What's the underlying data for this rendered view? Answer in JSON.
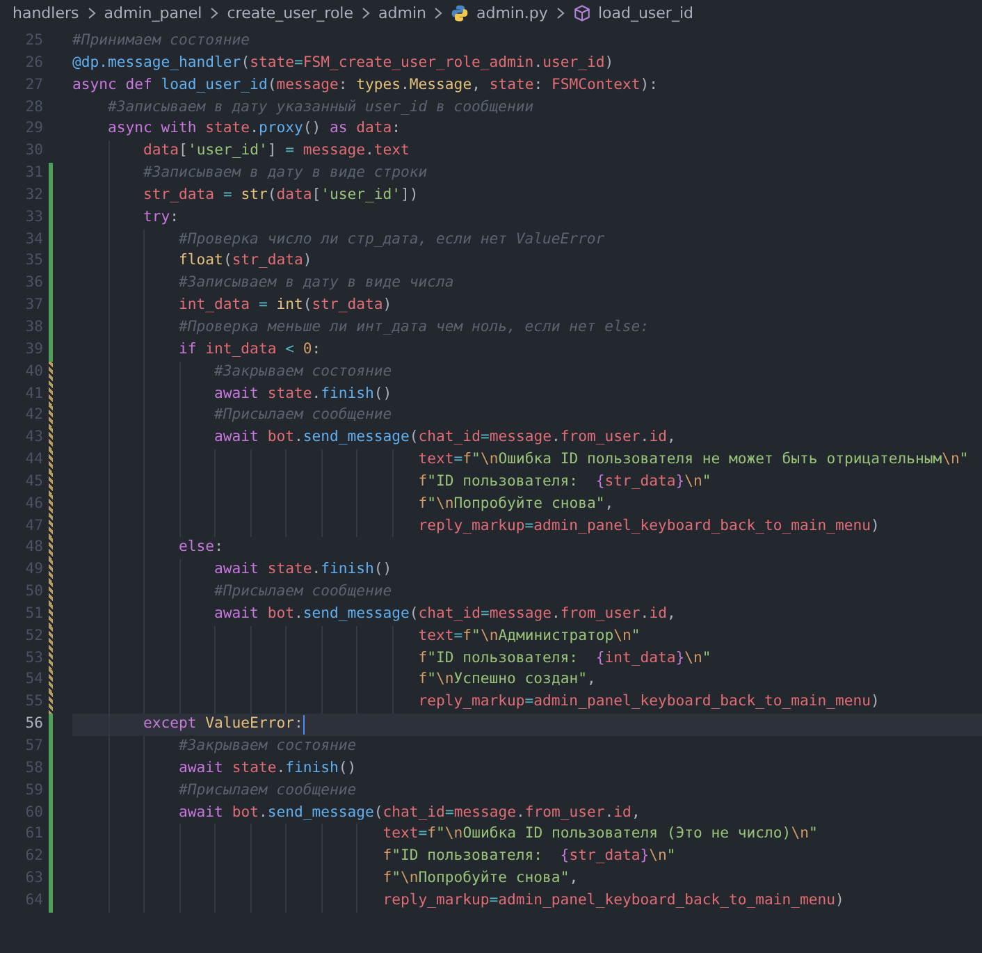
{
  "breadcrumb": [
    {
      "kind": "folder",
      "label": "handlers"
    },
    {
      "kind": "folder",
      "label": "admin_panel"
    },
    {
      "kind": "folder",
      "label": "create_user_role"
    },
    {
      "kind": "folder",
      "label": "admin"
    },
    {
      "kind": "file",
      "label": "admin.py"
    },
    {
      "kind": "symbol",
      "label": "load_user_id"
    }
  ],
  "lines": [
    {
      "number": "25",
      "added": false,
      "modified": false,
      "current": false,
      "tokens": [
        {
          "kind": "comment",
          "text": "#Принимаем состояние"
        }
      ]
    },
    {
      "number": "26",
      "added": false,
      "modified": false,
      "current": false,
      "tokens": [
        {
          "kind": "function",
          "text": "@dp.message_handler"
        },
        {
          "kind": "punct",
          "text": "("
        },
        {
          "kind": "variable",
          "text": "state"
        },
        {
          "kind": "operator",
          "text": "="
        },
        {
          "kind": "variable",
          "text": "FSM_create_user_role_admin"
        },
        {
          "kind": "punct",
          "text": "."
        },
        {
          "kind": "variable",
          "text": "user_id"
        },
        {
          "kind": "punct",
          "text": ")"
        }
      ]
    },
    {
      "number": "27",
      "added": false,
      "modified": false,
      "current": false,
      "tokens": [
        {
          "kind": "keyword",
          "text": "async def "
        },
        {
          "kind": "function",
          "text": "load_user_id"
        },
        {
          "kind": "punct",
          "text": "("
        },
        {
          "kind": "variable",
          "text": "message"
        },
        {
          "kind": "punct",
          "text": ": "
        },
        {
          "kind": "type",
          "text": "types"
        },
        {
          "kind": "punct",
          "text": "."
        },
        {
          "kind": "type",
          "text": "Message"
        },
        {
          "kind": "punct",
          "text": ", "
        },
        {
          "kind": "variable",
          "text": "state"
        },
        {
          "kind": "punct",
          "text": ": "
        },
        {
          "kind": "variable",
          "text": "FSMContext"
        },
        {
          "kind": "punct",
          "text": "):"
        }
      ]
    },
    {
      "number": "28",
      "added": false,
      "modified": false,
      "current": false,
      "tokens": [
        {
          "kind": "comment",
          "text": "    #Записываем в дату указанный user_id в сообщении"
        }
      ]
    },
    {
      "number": "29",
      "added": false,
      "modified": false,
      "current": false,
      "tokens": [
        {
          "kind": "keyword",
          "text": "    async with "
        },
        {
          "kind": "variable",
          "text": "state"
        },
        {
          "kind": "punct",
          "text": "."
        },
        {
          "kind": "function",
          "text": "proxy"
        },
        {
          "kind": "punct",
          "text": "() "
        },
        {
          "kind": "keyword",
          "text": "as "
        },
        {
          "kind": "variable",
          "text": "data"
        },
        {
          "kind": "punct",
          "text": ":"
        }
      ]
    },
    {
      "number": "30",
      "added": false,
      "modified": false,
      "current": false,
      "tokens": [
        {
          "kind": "variable",
          "text": "        data"
        },
        {
          "kind": "punct",
          "text": "["
        },
        {
          "kind": "string",
          "text": "'user_id'"
        },
        {
          "kind": "punct",
          "text": "] "
        },
        {
          "kind": "operator",
          "text": "= "
        },
        {
          "kind": "variable",
          "text": "message"
        },
        {
          "kind": "punct",
          "text": "."
        },
        {
          "kind": "variable",
          "text": "text"
        }
      ]
    },
    {
      "number": "31",
      "added": true,
      "modified": false,
      "current": false,
      "tokens": [
        {
          "kind": "comment",
          "text": "        #Записываем в дату в виде строки"
        }
      ]
    },
    {
      "number": "32",
      "added": true,
      "modified": false,
      "current": false,
      "tokens": [
        {
          "kind": "variable",
          "text": "        str_data"
        },
        {
          "kind": "operator",
          "text": " = "
        },
        {
          "kind": "type",
          "text": "str"
        },
        {
          "kind": "punct",
          "text": "("
        },
        {
          "kind": "variable",
          "text": "data"
        },
        {
          "kind": "punct",
          "text": "["
        },
        {
          "kind": "string",
          "text": "'user_id'"
        },
        {
          "kind": "punct",
          "text": "])"
        }
      ]
    },
    {
      "number": "33",
      "added": true,
      "modified": false,
      "current": false,
      "tokens": [
        {
          "kind": "keyword",
          "text": "        try"
        },
        {
          "kind": "punct",
          "text": ":"
        }
      ]
    },
    {
      "number": "34",
      "added": true,
      "modified": false,
      "current": false,
      "tokens": [
        {
          "kind": "comment",
          "text": "            #Проверка число ли стр_дата, если нет ValueError"
        }
      ]
    },
    {
      "number": "35",
      "added": true,
      "modified": false,
      "current": false,
      "tokens": [
        {
          "kind": "type",
          "text": "            float"
        },
        {
          "kind": "punct",
          "text": "("
        },
        {
          "kind": "variable",
          "text": "str_data"
        },
        {
          "kind": "punct",
          "text": ")"
        }
      ]
    },
    {
      "number": "36",
      "added": true,
      "modified": false,
      "current": false,
      "tokens": [
        {
          "kind": "comment",
          "text": "            #Записываем в дату в виде числа"
        }
      ]
    },
    {
      "number": "37",
      "added": true,
      "modified": false,
      "current": false,
      "tokens": [
        {
          "kind": "variable",
          "text": "            int_data"
        },
        {
          "kind": "operator",
          "text": " = "
        },
        {
          "kind": "type",
          "text": "int"
        },
        {
          "kind": "punct",
          "text": "("
        },
        {
          "kind": "variable",
          "text": "str_data"
        },
        {
          "kind": "punct",
          "text": ")"
        }
      ]
    },
    {
      "number": "38",
      "added": true,
      "modified": false,
      "current": false,
      "tokens": [
        {
          "kind": "comment",
          "text": "            #Проверка меньше ли инт_дата чем ноль, если нет else:"
        }
      ]
    },
    {
      "number": "39",
      "added": true,
      "modified": false,
      "current": false,
      "tokens": [
        {
          "kind": "keyword",
          "text": "            if "
        },
        {
          "kind": "variable",
          "text": "int_data"
        },
        {
          "kind": "operator",
          "text": " < "
        },
        {
          "kind": "number",
          "text": "0"
        },
        {
          "kind": "punct",
          "text": ":"
        }
      ]
    },
    {
      "number": "40",
      "added": false,
      "modified": true,
      "current": false,
      "tokens": [
        {
          "kind": "comment",
          "text": "                #Закрываем состояние"
        }
      ]
    },
    {
      "number": "41",
      "added": false,
      "modified": true,
      "current": false,
      "tokens": [
        {
          "kind": "keyword",
          "text": "                await "
        },
        {
          "kind": "variable",
          "text": "state"
        },
        {
          "kind": "punct",
          "text": "."
        },
        {
          "kind": "function",
          "text": "finish"
        },
        {
          "kind": "punct",
          "text": "()"
        }
      ]
    },
    {
      "number": "42",
      "added": false,
      "modified": true,
      "current": false,
      "tokens": [
        {
          "kind": "comment",
          "text": "                #Присылаем сообщение"
        }
      ]
    },
    {
      "number": "43",
      "added": false,
      "modified": true,
      "current": false,
      "tokens": [
        {
          "kind": "keyword",
          "text": "                await "
        },
        {
          "kind": "variable",
          "text": "bot"
        },
        {
          "kind": "punct",
          "text": "."
        },
        {
          "kind": "function",
          "text": "send_message"
        },
        {
          "kind": "punct",
          "text": "("
        },
        {
          "kind": "variable",
          "text": "chat_id"
        },
        {
          "kind": "operator",
          "text": "="
        },
        {
          "kind": "variable",
          "text": "message"
        },
        {
          "kind": "punct",
          "text": "."
        },
        {
          "kind": "variable",
          "text": "from_user"
        },
        {
          "kind": "punct",
          "text": "."
        },
        {
          "kind": "variable",
          "text": "id"
        },
        {
          "kind": "punct",
          "text": ","
        }
      ]
    },
    {
      "number": "44",
      "added": false,
      "modified": true,
      "current": false,
      "tokens": [
        {
          "kind": "variable",
          "text": "                                       text"
        },
        {
          "kind": "operator",
          "text": "="
        },
        {
          "kind": "number",
          "text": "f"
        },
        {
          "kind": "string",
          "text": "\""
        },
        {
          "kind": "number",
          "text": "\\n"
        },
        {
          "kind": "string",
          "text": "Ошибка ID пользователя не может быть отрицательным"
        },
        {
          "kind": "number",
          "text": "\\n"
        },
        {
          "kind": "string",
          "text": "\""
        }
      ]
    },
    {
      "number": "45",
      "added": false,
      "modified": true,
      "current": false,
      "tokens": [
        {
          "kind": "number",
          "text": "                                       f"
        },
        {
          "kind": "string",
          "text": "\"ID пользователя:  "
        },
        {
          "kind": "keyword",
          "text": "{"
        },
        {
          "kind": "variable",
          "text": "str_data"
        },
        {
          "kind": "keyword",
          "text": "}"
        },
        {
          "kind": "number",
          "text": "\\n"
        },
        {
          "kind": "string",
          "text": "\""
        }
      ]
    },
    {
      "number": "46",
      "added": false,
      "modified": true,
      "current": false,
      "tokens": [
        {
          "kind": "number",
          "text": "                                       f"
        },
        {
          "kind": "string",
          "text": "\""
        },
        {
          "kind": "number",
          "text": "\\n"
        },
        {
          "kind": "string",
          "text": "Попробуйте снова\""
        },
        {
          "kind": "punct",
          "text": ","
        }
      ]
    },
    {
      "number": "47",
      "added": false,
      "modified": true,
      "current": false,
      "tokens": [
        {
          "kind": "variable",
          "text": "                                       reply_markup"
        },
        {
          "kind": "operator",
          "text": "="
        },
        {
          "kind": "variable",
          "text": "admin_panel_keyboard_back_to_main_menu"
        },
        {
          "kind": "punct",
          "text": ")"
        }
      ]
    },
    {
      "number": "48",
      "added": false,
      "modified": true,
      "current": false,
      "tokens": [
        {
          "kind": "keyword",
          "text": "            else"
        },
        {
          "kind": "punct",
          "text": ":"
        }
      ]
    },
    {
      "number": "49",
      "added": false,
      "modified": true,
      "current": false,
      "tokens": [
        {
          "kind": "keyword",
          "text": "                await "
        },
        {
          "kind": "variable",
          "text": "state"
        },
        {
          "kind": "punct",
          "text": "."
        },
        {
          "kind": "function",
          "text": "finish"
        },
        {
          "kind": "punct",
          "text": "()"
        }
      ]
    },
    {
      "number": "50",
      "added": false,
      "modified": true,
      "current": false,
      "tokens": [
        {
          "kind": "comment",
          "text": "                #Присылаем сообщение"
        }
      ]
    },
    {
      "number": "51",
      "added": false,
      "modified": true,
      "current": false,
      "tokens": [
        {
          "kind": "keyword",
          "text": "                await "
        },
        {
          "kind": "variable",
          "text": "bot"
        },
        {
          "kind": "punct",
          "text": "."
        },
        {
          "kind": "function",
          "text": "send_message"
        },
        {
          "kind": "punct",
          "text": "("
        },
        {
          "kind": "variable",
          "text": "chat_id"
        },
        {
          "kind": "operator",
          "text": "="
        },
        {
          "kind": "variable",
          "text": "message"
        },
        {
          "kind": "punct",
          "text": "."
        },
        {
          "kind": "variable",
          "text": "from_user"
        },
        {
          "kind": "punct",
          "text": "."
        },
        {
          "kind": "variable",
          "text": "id"
        },
        {
          "kind": "punct",
          "text": ","
        }
      ]
    },
    {
      "number": "52",
      "added": false,
      "modified": true,
      "current": false,
      "tokens": [
        {
          "kind": "variable",
          "text": "                                       text"
        },
        {
          "kind": "operator",
          "text": "="
        },
        {
          "kind": "number",
          "text": "f"
        },
        {
          "kind": "string",
          "text": "\""
        },
        {
          "kind": "number",
          "text": "\\n"
        },
        {
          "kind": "string",
          "text": "Администратор"
        },
        {
          "kind": "number",
          "text": "\\n"
        },
        {
          "kind": "string",
          "text": "\""
        }
      ]
    },
    {
      "number": "53",
      "added": false,
      "modified": true,
      "current": false,
      "tokens": [
        {
          "kind": "number",
          "text": "                                       f"
        },
        {
          "kind": "string",
          "text": "\"ID пользователя:  "
        },
        {
          "kind": "keyword",
          "text": "{"
        },
        {
          "kind": "variable",
          "text": "int_data"
        },
        {
          "kind": "keyword",
          "text": "}"
        },
        {
          "kind": "number",
          "text": "\\n"
        },
        {
          "kind": "string",
          "text": "\""
        }
      ]
    },
    {
      "number": "54",
      "added": false,
      "modified": true,
      "current": false,
      "tokens": [
        {
          "kind": "number",
          "text": "                                       f"
        },
        {
          "kind": "string",
          "text": "\""
        },
        {
          "kind": "number",
          "text": "\\n"
        },
        {
          "kind": "string",
          "text": "Успешно создан\""
        },
        {
          "kind": "punct",
          "text": ","
        }
      ]
    },
    {
      "number": "55",
      "added": false,
      "modified": true,
      "current": false,
      "tokens": [
        {
          "kind": "variable",
          "text": "                                       reply_markup"
        },
        {
          "kind": "operator",
          "text": "="
        },
        {
          "kind": "variable",
          "text": "admin_panel_keyboard_back_to_main_menu"
        },
        {
          "kind": "punct",
          "text": ")"
        }
      ]
    },
    {
      "number": "56",
      "added": true,
      "modified": false,
      "current": true,
      "tokens": [
        {
          "kind": "keyword",
          "text": "        except "
        },
        {
          "kind": "type",
          "text": "ValueError"
        },
        {
          "kind": "punct",
          "text": ":"
        }
      ]
    },
    {
      "number": "57",
      "added": true,
      "modified": false,
      "current": false,
      "tokens": [
        {
          "kind": "comment",
          "text": "            #Закрываем состояние"
        }
      ]
    },
    {
      "number": "58",
      "added": true,
      "modified": false,
      "current": false,
      "tokens": [
        {
          "kind": "keyword",
          "text": "            await "
        },
        {
          "kind": "variable",
          "text": "state"
        },
        {
          "kind": "punct",
          "text": "."
        },
        {
          "kind": "function",
          "text": "finish"
        },
        {
          "kind": "punct",
          "text": "()"
        }
      ]
    },
    {
      "number": "59",
      "added": true,
      "modified": false,
      "current": false,
      "tokens": [
        {
          "kind": "comment",
          "text": "            #Присылаем сообщение"
        }
      ]
    },
    {
      "number": "60",
      "added": true,
      "modified": false,
      "current": false,
      "tokens": [
        {
          "kind": "keyword",
          "text": "            await "
        },
        {
          "kind": "variable",
          "text": "bot"
        },
        {
          "kind": "punct",
          "text": "."
        },
        {
          "kind": "function",
          "text": "send_message"
        },
        {
          "kind": "punct",
          "text": "("
        },
        {
          "kind": "variable",
          "text": "chat_id"
        },
        {
          "kind": "operator",
          "text": "="
        },
        {
          "kind": "variable",
          "text": "message"
        },
        {
          "kind": "punct",
          "text": "."
        },
        {
          "kind": "variable",
          "text": "from_user"
        },
        {
          "kind": "punct",
          "text": "."
        },
        {
          "kind": "variable",
          "text": "id"
        },
        {
          "kind": "punct",
          "text": ","
        }
      ]
    },
    {
      "number": "61",
      "added": true,
      "modified": false,
      "current": false,
      "tokens": [
        {
          "kind": "variable",
          "text": "                                   text"
        },
        {
          "kind": "operator",
          "text": "="
        },
        {
          "kind": "number",
          "text": "f"
        },
        {
          "kind": "string",
          "text": "\""
        },
        {
          "kind": "number",
          "text": "\\n"
        },
        {
          "kind": "string",
          "text": "Ошибка ID пользователя (Это не число)"
        },
        {
          "kind": "number",
          "text": "\\n"
        },
        {
          "kind": "string",
          "text": "\""
        }
      ]
    },
    {
      "number": "62",
      "added": true,
      "modified": false,
      "current": false,
      "tokens": [
        {
          "kind": "number",
          "text": "                                   f"
        },
        {
          "kind": "string",
          "text": "\"ID пользователя:  "
        },
        {
          "kind": "keyword",
          "text": "{"
        },
        {
          "kind": "variable",
          "text": "str_data"
        },
        {
          "kind": "keyword",
          "text": "}"
        },
        {
          "kind": "number",
          "text": "\\n"
        },
        {
          "kind": "string",
          "text": "\""
        }
      ]
    },
    {
      "number": "63",
      "added": true,
      "modified": false,
      "current": false,
      "tokens": [
        {
          "kind": "number",
          "text": "                                   f"
        },
        {
          "kind": "string",
          "text": "\""
        },
        {
          "kind": "number",
          "text": "\\n"
        },
        {
          "kind": "string",
          "text": "Попробуйте снова\""
        },
        {
          "kind": "punct",
          "text": ","
        }
      ]
    },
    {
      "number": "64",
      "added": true,
      "modified": false,
      "current": false,
      "tokens": [
        {
          "kind": "variable",
          "text": "                                   reply_markup"
        },
        {
          "kind": "operator",
          "text": "="
        },
        {
          "kind": "variable",
          "text": "admin_panel_keyboard_back_to_main_menu"
        },
        {
          "kind": "punct",
          "text": ")"
        }
      ]
    }
  ]
}
